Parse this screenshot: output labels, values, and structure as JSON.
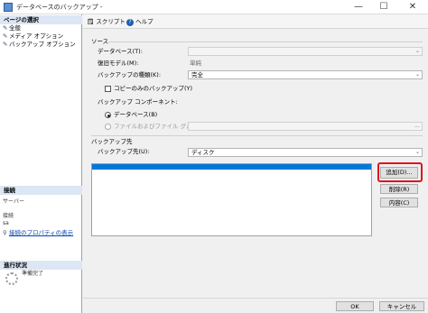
{
  "window": {
    "title": "データベースのバックアップ - ",
    "controls": {
      "minimize": "—",
      "maximize": "☐",
      "close": "✕"
    }
  },
  "sidebar": {
    "page_select_header": "ページの選択",
    "pages": [
      {
        "label": "全般",
        "icon": "wrench-icon"
      },
      {
        "label": "メディア オプション",
        "icon": "wrench-icon"
      },
      {
        "label": "バックアップ オプション",
        "icon": "wrench-icon"
      }
    ],
    "connection_header": "接続",
    "server_label": "サーバー",
    "connection_label": "接続",
    "connection_value": "sa",
    "connection_props_link": "接続のプロパティの表示",
    "progress_header": "進行状況",
    "progress_status": "準備完了"
  },
  "toolbar": {
    "script_label": "スクリプト",
    "script_dropdown": "▼",
    "help_label": "ヘルプ"
  },
  "source": {
    "section_label": "ソース",
    "database_label": "データベース(T):",
    "recovery_model_label": "復旧モデル(M):",
    "recovery_model_value": "単純",
    "backup_type_label": "バックアップの種類(K):",
    "backup_type_value": "完全",
    "copy_only_label": "コピーのみのバックアップ(Y)",
    "component_label": "バックアップ コンポーネント:",
    "component_database": "データベース(B)",
    "component_files": "ファイルおよびファイル グループ(G):"
  },
  "destination": {
    "section_label": "バックアップ先",
    "backup_to_label": "バックアップ先(U):",
    "backup_to_value": "ディスク",
    "add_button": "追加(D)...",
    "remove_button": "削除(R)",
    "contents_button": "内容(C)"
  },
  "footer": {
    "ok_button": "OK",
    "cancel_button": "キャンセル"
  },
  "colors": {
    "selection_blue": "#0078d7",
    "highlight_red": "#d9181f"
  }
}
